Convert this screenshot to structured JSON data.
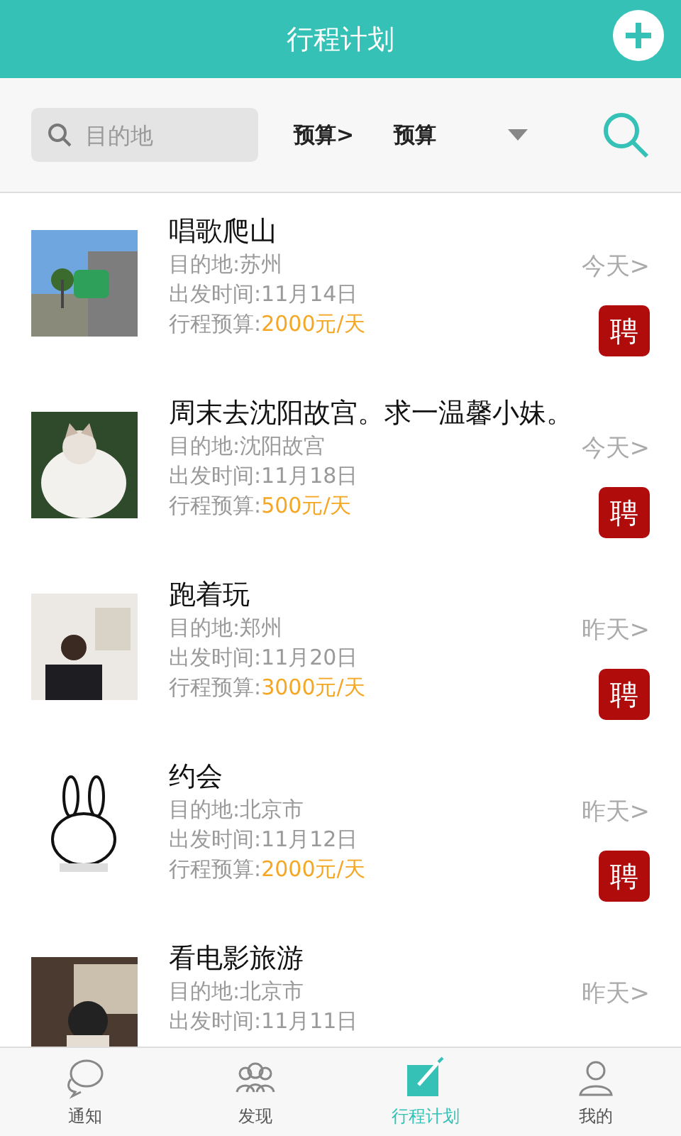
{
  "header": {
    "title": "行程计划"
  },
  "filter": {
    "search_placeholder": "目的地",
    "budget_label": "预算>",
    "budget_select": "预算"
  },
  "trips": [
    {
      "title": "唱歌爬山",
      "destination": "目的地:苏州",
      "departure": "出发时间:11月14日",
      "budget_label": "行程预算:",
      "budget_value": "2000元/天",
      "when": "今天>",
      "badge": "聘"
    },
    {
      "title": "周末去沈阳故宫。求一温馨小妹。",
      "destination": "目的地:沈阳故宫",
      "departure": "出发时间:11月18日",
      "budget_label": "行程预算:",
      "budget_value": "500元/天",
      "when": "今天>",
      "badge": "聘"
    },
    {
      "title": "跑着玩",
      "destination": "目的地:郑州",
      "departure": "出发时间:11月20日",
      "budget_label": "行程预算:",
      "budget_value": "3000元/天",
      "when": "昨天>",
      "badge": "聘"
    },
    {
      "title": "约会",
      "destination": "目的地:北京市",
      "departure": "出发时间:11月12日",
      "budget_label": "行程预算:",
      "budget_value": "2000元/天",
      "when": "昨天>",
      "badge": "聘"
    },
    {
      "title": "看电影旅游",
      "destination": "目的地:北京市",
      "departure": "出发时间:11月11日",
      "when": "昨天>"
    }
  ],
  "tabs": [
    {
      "label": "通知",
      "selected": false
    },
    {
      "label": "发现",
      "selected": false
    },
    {
      "label": "行程计划",
      "selected": true
    },
    {
      "label": "我的",
      "selected": false
    }
  ]
}
